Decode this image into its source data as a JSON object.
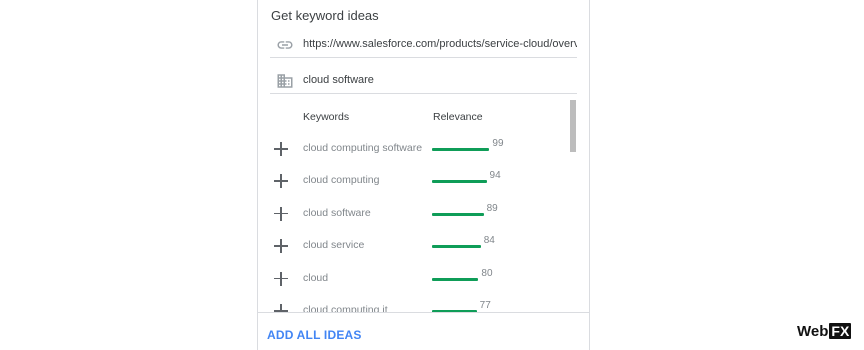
{
  "panel": {
    "title": "Get keyword ideas",
    "url_field": {
      "icon": "link-icon",
      "value": "https://www.salesforce.com/products/service-cloud/overv"
    },
    "keyword_field": {
      "icon": "building-icon",
      "value": "cloud software"
    },
    "table": {
      "headers": {
        "keywords": "Keywords",
        "relevance": "Relevance"
      },
      "rows": [
        {
          "keyword": "cloud computing software",
          "relevance": 99
        },
        {
          "keyword": "cloud computing",
          "relevance": 94
        },
        {
          "keyword": "cloud software",
          "relevance": 89
        },
        {
          "keyword": "cloud service",
          "relevance": 84
        },
        {
          "keyword": "cloud",
          "relevance": 80
        },
        {
          "keyword": "cloud computing it",
          "relevance": 77
        }
      ]
    },
    "add_all_label": "ADD ALL IDEAS"
  },
  "brand": {
    "logo_text": "Web",
    "logo_text_box": "FX"
  },
  "colors": {
    "bar": "#0f9d58",
    "link": "#4285f4"
  }
}
